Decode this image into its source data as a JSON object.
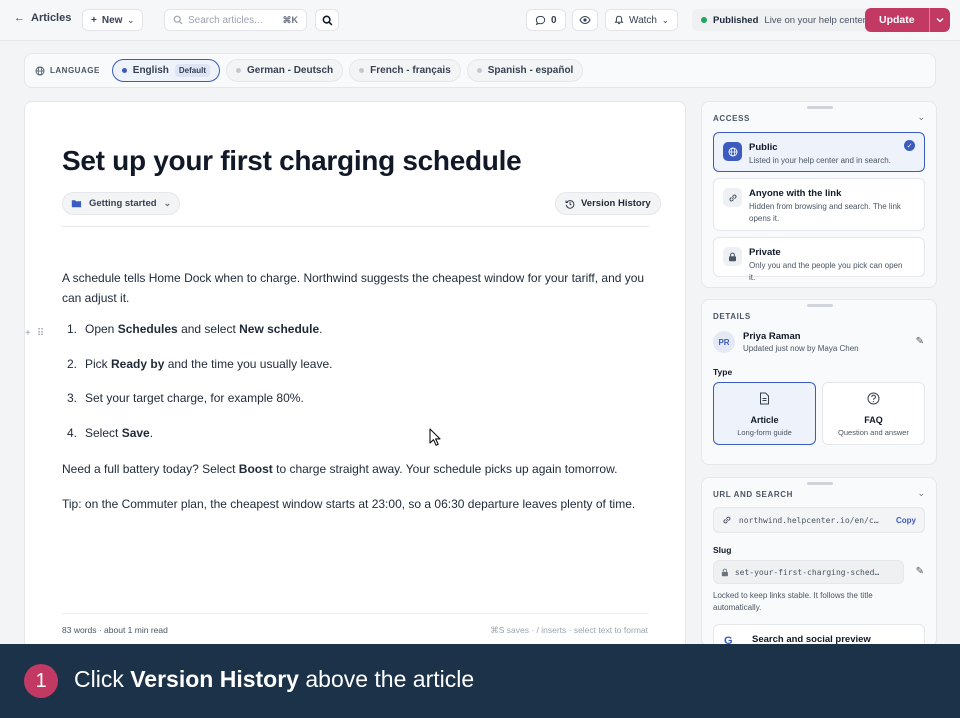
{
  "topbar": {
    "back_label": "Articles",
    "new_label": "New",
    "search_placeholder": "Search articles...",
    "search_shortcut": "⌘K",
    "comment_count": "0",
    "watch_label": "Watch",
    "status_label": "Published",
    "status_detail": "Live on your help center",
    "update_label": "Update",
    "colors": {
      "accent": "#c23a64",
      "status_green": "#22a55b",
      "selection_blue": "#3b5bbf"
    }
  },
  "languages": {
    "label": "LANGUAGE",
    "items": [
      {
        "label": "English",
        "badge": "Default",
        "active": true
      },
      {
        "label": "German - Deutsch",
        "active": false
      },
      {
        "label": "French - français",
        "active": false
      },
      {
        "label": "Spanish - español",
        "active": false
      }
    ]
  },
  "article": {
    "title": "Set up your first charging schedule",
    "category": "Getting started",
    "version_history_label": "Version History",
    "intro": "A schedule tells Home Dock when to charge. Northwind suggests the cheapest window for your tariff, and you can adjust it.",
    "steps": [
      {
        "num": "1.",
        "pre": "Open ",
        "b1": "Schedules",
        "mid": " and select ",
        "b2": "New schedule",
        "post": "."
      },
      {
        "num": "2.",
        "pre": "Pick ",
        "b1": "Ready by",
        "mid": " and the time you usually leave.",
        "b2": "",
        "post": ""
      },
      {
        "num": "3.",
        "pre": "Set your target charge, for example 80%.",
        "b1": "",
        "mid": "",
        "b2": "",
        "post": ""
      },
      {
        "num": "4.",
        "pre": "Select ",
        "b1": "Save",
        "mid": ".",
        "b2": "",
        "post": ""
      }
    ],
    "boost_pre": "Need a full battery today? Select ",
    "boost_bold": "Boost",
    "boost_post": " to charge straight away. Your schedule picks up again tomorrow.",
    "tip": "Tip: on the Commuter plan, the cheapest window starts at 23:00, so a 06:30 departure leaves plenty of time.",
    "word_count": "83 words · about 1 min read",
    "shortcuts_hint": "⌘S saves · / inserts · select text to format"
  },
  "access": {
    "heading": "ACCESS",
    "options": [
      {
        "title": "Public",
        "desc": "Listed in your help center and in search.",
        "selected": true,
        "icon": "globe-icon"
      },
      {
        "title": "Anyone with the link",
        "desc": "Hidden from browsing and search. The link opens it.",
        "selected": false,
        "icon": "link-icon"
      },
      {
        "title": "Private",
        "desc": "Only you and the people you pick can open it.",
        "selected": false,
        "icon": "lock-icon"
      }
    ]
  },
  "details": {
    "heading": "DETAILS",
    "avatar_initials": "PR",
    "author": "Priya Raman",
    "updated": "Updated just now by Maya Chen",
    "type_label": "Type",
    "types": [
      {
        "title": "Article",
        "desc": "Long-form guide",
        "selected": true
      },
      {
        "title": "FAQ",
        "desc": "Question and answer",
        "selected": false
      }
    ]
  },
  "url_search": {
    "heading": "URL AND SEARCH",
    "url": "northwind.helpcenter.io/en/c…",
    "copy_label": "Copy",
    "slug_label": "Slug",
    "slug": "set-your-first-charging-sched…",
    "slug_note": "Locked to keep links stable. It follows the title automatically.",
    "seo_label": "Search and social preview",
    "seo_icon_text": "G"
  },
  "banner": {
    "step": "1",
    "pre": "Click ",
    "bold": "Version History",
    "post": " above the article"
  }
}
